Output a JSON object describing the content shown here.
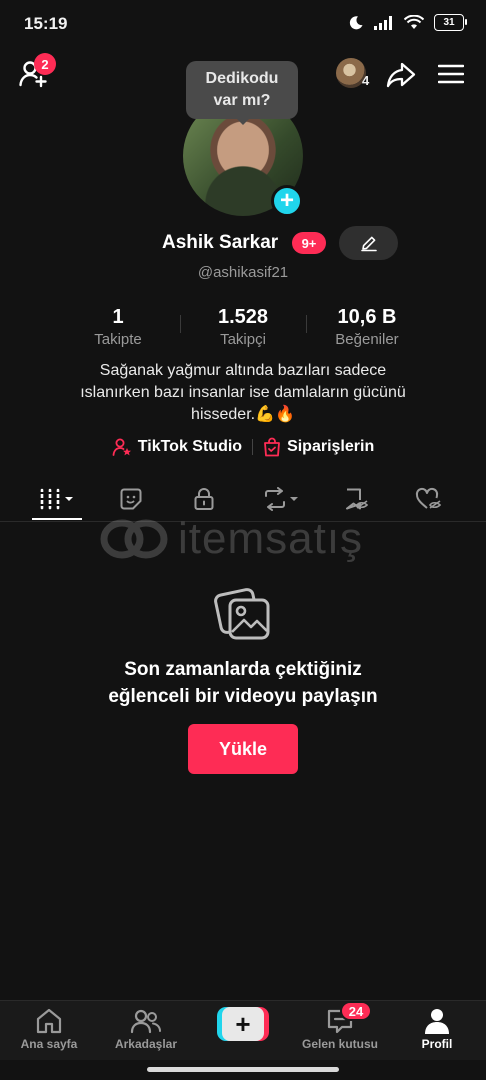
{
  "status_bar": {
    "time": "15:19",
    "battery": "31"
  },
  "top_bar": {
    "friend_requests_badge": "2",
    "visitor_count": "4"
  },
  "tooltip": {
    "line1": "Dedikodu",
    "line2": "var mı?"
  },
  "profile": {
    "display_name": "Ashik Sarkar",
    "badge": "9+",
    "username": "@ashikasif21",
    "bio_line1": "Sağanak yağmur altında bazıları sadece",
    "bio_line2": "ıslanırken bazı insanlar ise damlaların gücünü",
    "bio_line3": "hisseder.💪🔥"
  },
  "stats": [
    {
      "value": "1",
      "label": "Takipte"
    },
    {
      "value": "1.528",
      "label": "Takipçi"
    },
    {
      "value": "10,6 B",
      "label": "Beğeniler"
    }
  ],
  "links": {
    "studio": "TikTok Studio",
    "orders": "Siparişlerin"
  },
  "tabs": [
    "videos-grid",
    "stickers",
    "private",
    "reposts",
    "favorites",
    "liked"
  ],
  "watermark": {
    "text": "itemsatış"
  },
  "empty_state": {
    "line1": "Son zamanlarda çektiğiniz",
    "line2": "eğlenceli bir videoyu paylaşın",
    "button": "Yükle"
  },
  "bottom_nav": {
    "home": "Ana sayfa",
    "friends": "Arkadaşlar",
    "inbox": "Gelen kutusu",
    "inbox_badge": "24",
    "profile": "Profil"
  },
  "colors": {
    "accent": "#fe2c55",
    "cyan": "#20d5ec",
    "background": "#121212"
  }
}
